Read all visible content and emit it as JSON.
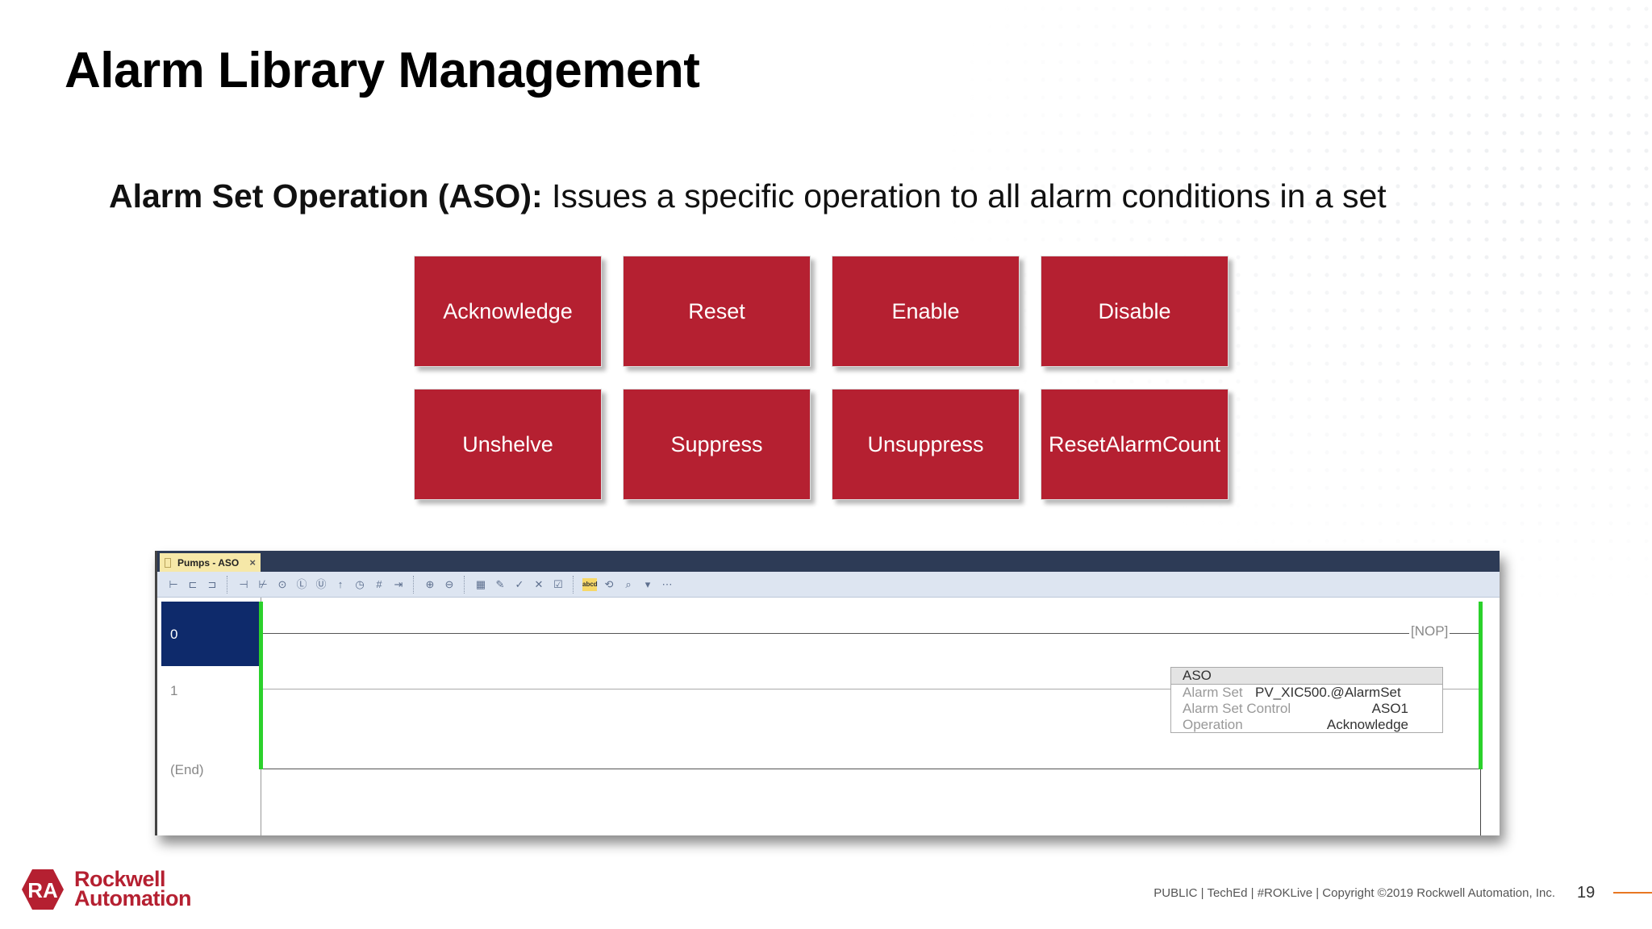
{
  "slide": {
    "title": "Alarm Library Management",
    "subtitle_bold": "Alarm Set Operation (ASO):",
    "subtitle_rest": " Issues a specific operation to all alarm conditions in a set"
  },
  "operations": [
    "Acknowledge",
    "Reset",
    "Enable",
    "Disable",
    "Unshelve",
    "Suppress",
    "Unsuppress",
    "ResetAlarmCount"
  ],
  "colors": {
    "operation_button": "#b52031",
    "rung_rail": "#2bd12b",
    "selected_rung": "#0e2a6b",
    "tab_bar": "#2d3b56",
    "accent_line": "#e87722"
  },
  "editor": {
    "tab_label": "Pumps - ASO",
    "tab_close": "×",
    "rungs": [
      {
        "number": "0",
        "instruction": "NOP"
      },
      {
        "number": "1"
      },
      {
        "number": "(End)"
      }
    ],
    "aso_block": {
      "name": "ASO",
      "rows": [
        {
          "label": "Alarm Set",
          "value": "PV_XIC500.@AlarmSet"
        },
        {
          "label": "Alarm Set Control",
          "value": "ASO1"
        },
        {
          "label": "Operation",
          "value": "Acknowledge"
        }
      ]
    },
    "toolbar_highlight_label": "abcd"
  },
  "footer": {
    "brand_line1": "Rockwell",
    "brand_line2": "Automation",
    "brand_mark": "RA",
    "legal": "PUBLIC | TechEd | #ROKLive | Copyright ©2019 Rockwell Automation, Inc.",
    "page_number": "19"
  }
}
